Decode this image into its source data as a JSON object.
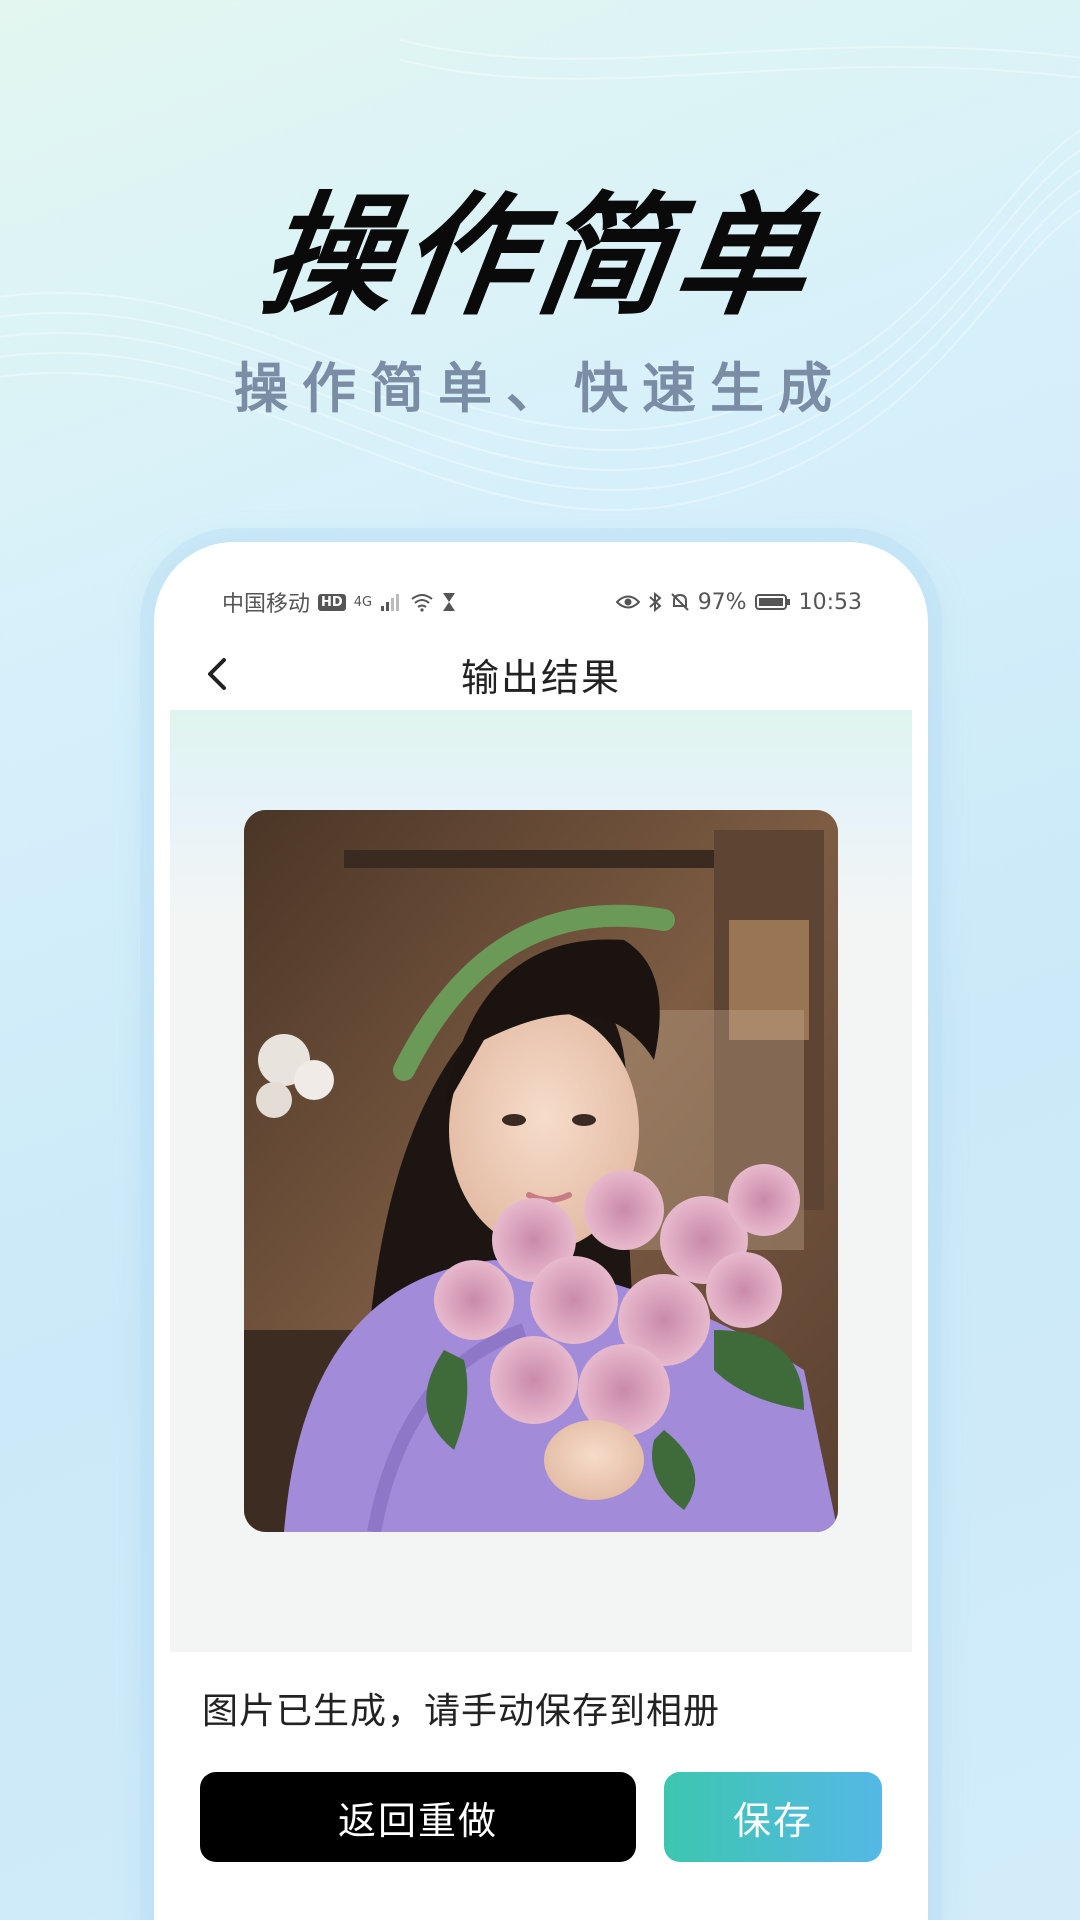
{
  "hero": {
    "title": "操作简单",
    "subtitle": "操作简单、快速生成"
  },
  "status_bar": {
    "carrier": "中国移动",
    "hd": "HD",
    "network": "4G",
    "battery": "97%",
    "time": "10:53"
  },
  "nav": {
    "title": "输出结果",
    "back_icon": "chevron-left-icon"
  },
  "result": {
    "image_alt": "生成的人像照片",
    "note": "图片已生成，请手动保存到相册"
  },
  "actions": {
    "redo_label": "返回重做",
    "save_label": "保存"
  },
  "colors": {
    "save_gradient_start": "#3cc6b0",
    "save_gradient_end": "#55b8e6",
    "redo_bg": "#000000"
  }
}
